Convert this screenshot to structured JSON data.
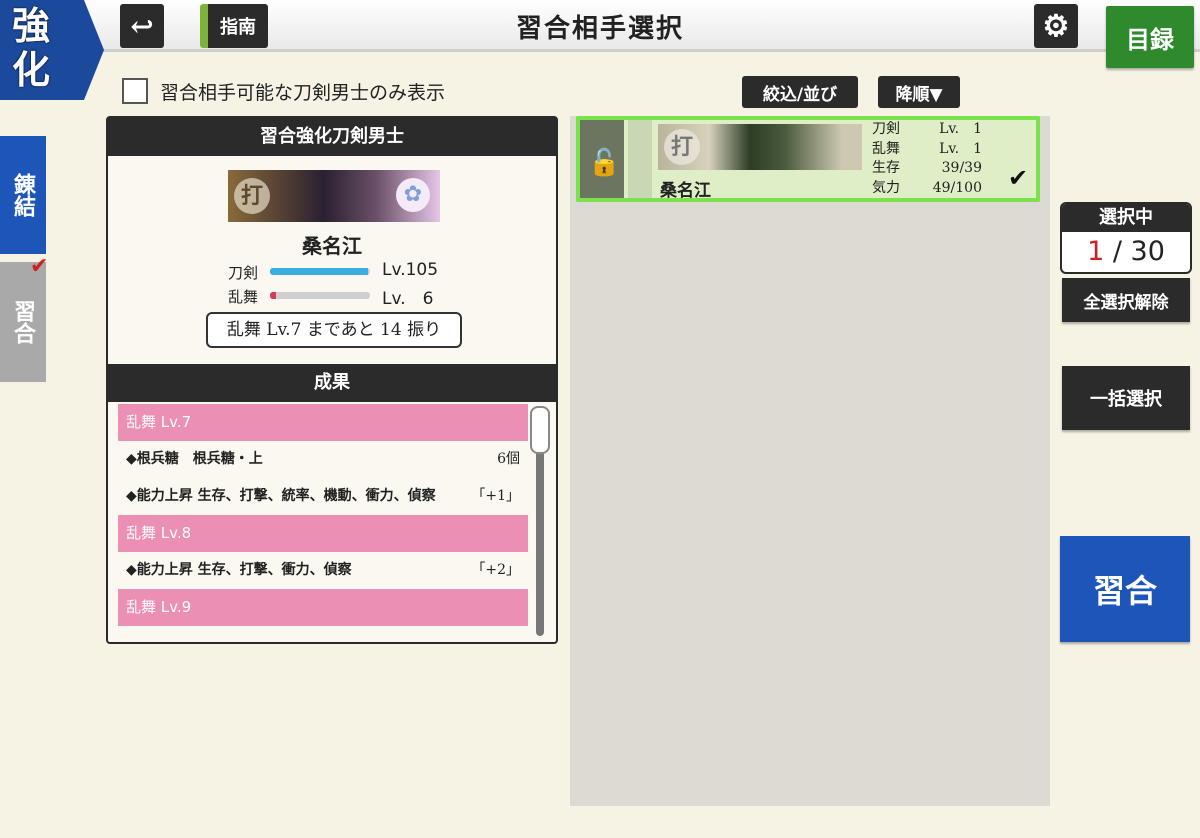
{
  "header": {
    "mode_tab": [
      "強",
      "化"
    ],
    "title": "習合相手選択",
    "back_icon": "↩",
    "guide_label": "指南",
    "settings_icon": "⚙",
    "catalog_label": "目録"
  },
  "side_tabs": [
    {
      "label": "錬結",
      "active": true
    },
    {
      "label": "習合",
      "active": false
    }
  ],
  "filter": {
    "only_label": "習合相手可能な刀剣男士のみ表示",
    "filter_label": "絞込/並び",
    "order_label": "降順▼"
  },
  "left_panel": {
    "heading": "習合強化刀剣男士",
    "banner_type": "打",
    "name": "桑名江",
    "levels": [
      {
        "label": "刀剣",
        "value": "Lv.105",
        "fill": 0.98,
        "color": "#3aaee0"
      },
      {
        "label": "乱舞",
        "value": "Lv.　6",
        "fill": 0.06,
        "color": "#d43c5a"
      }
    ],
    "hint": "乱舞 Lv.7 まであと 14 振り",
    "results_heading": "成果",
    "results": [
      {
        "kind": "pink",
        "text": "乱舞 Lv.7"
      },
      {
        "kind": "item",
        "text": "◆根兵糖　根兵糖・上",
        "right": "6個"
      },
      {
        "kind": "item",
        "text": "◆能力上昇 生存、打撃、統率、機動、衝力、偵察",
        "right": "「+1」"
      },
      {
        "kind": "pink",
        "text": "乱舞 Lv.8"
      },
      {
        "kind": "item",
        "text": "◆能力上昇 生存、打撃、衝力、偵察",
        "right": "「+2」"
      },
      {
        "kind": "pink",
        "text": "乱舞 Lv.9"
      }
    ]
  },
  "card": {
    "type": "打",
    "name": "桑名江",
    "stats": [
      {
        "label": "刀剣",
        "value": "Lv.　1"
      },
      {
        "label": "乱舞",
        "value": "Lv.　1"
      },
      {
        "label": "生存",
        "value": "39/39"
      },
      {
        "label": "気力",
        "value": "49/100"
      }
    ],
    "lock_icon": "🔓",
    "check_icon": "✔"
  },
  "selection": {
    "heading": "選択中",
    "current": "1",
    "separator": " / ",
    "max": "30"
  },
  "buttons": {
    "clear": "全選択解除",
    "bulk": "一括選択",
    "execute": "習合"
  }
}
